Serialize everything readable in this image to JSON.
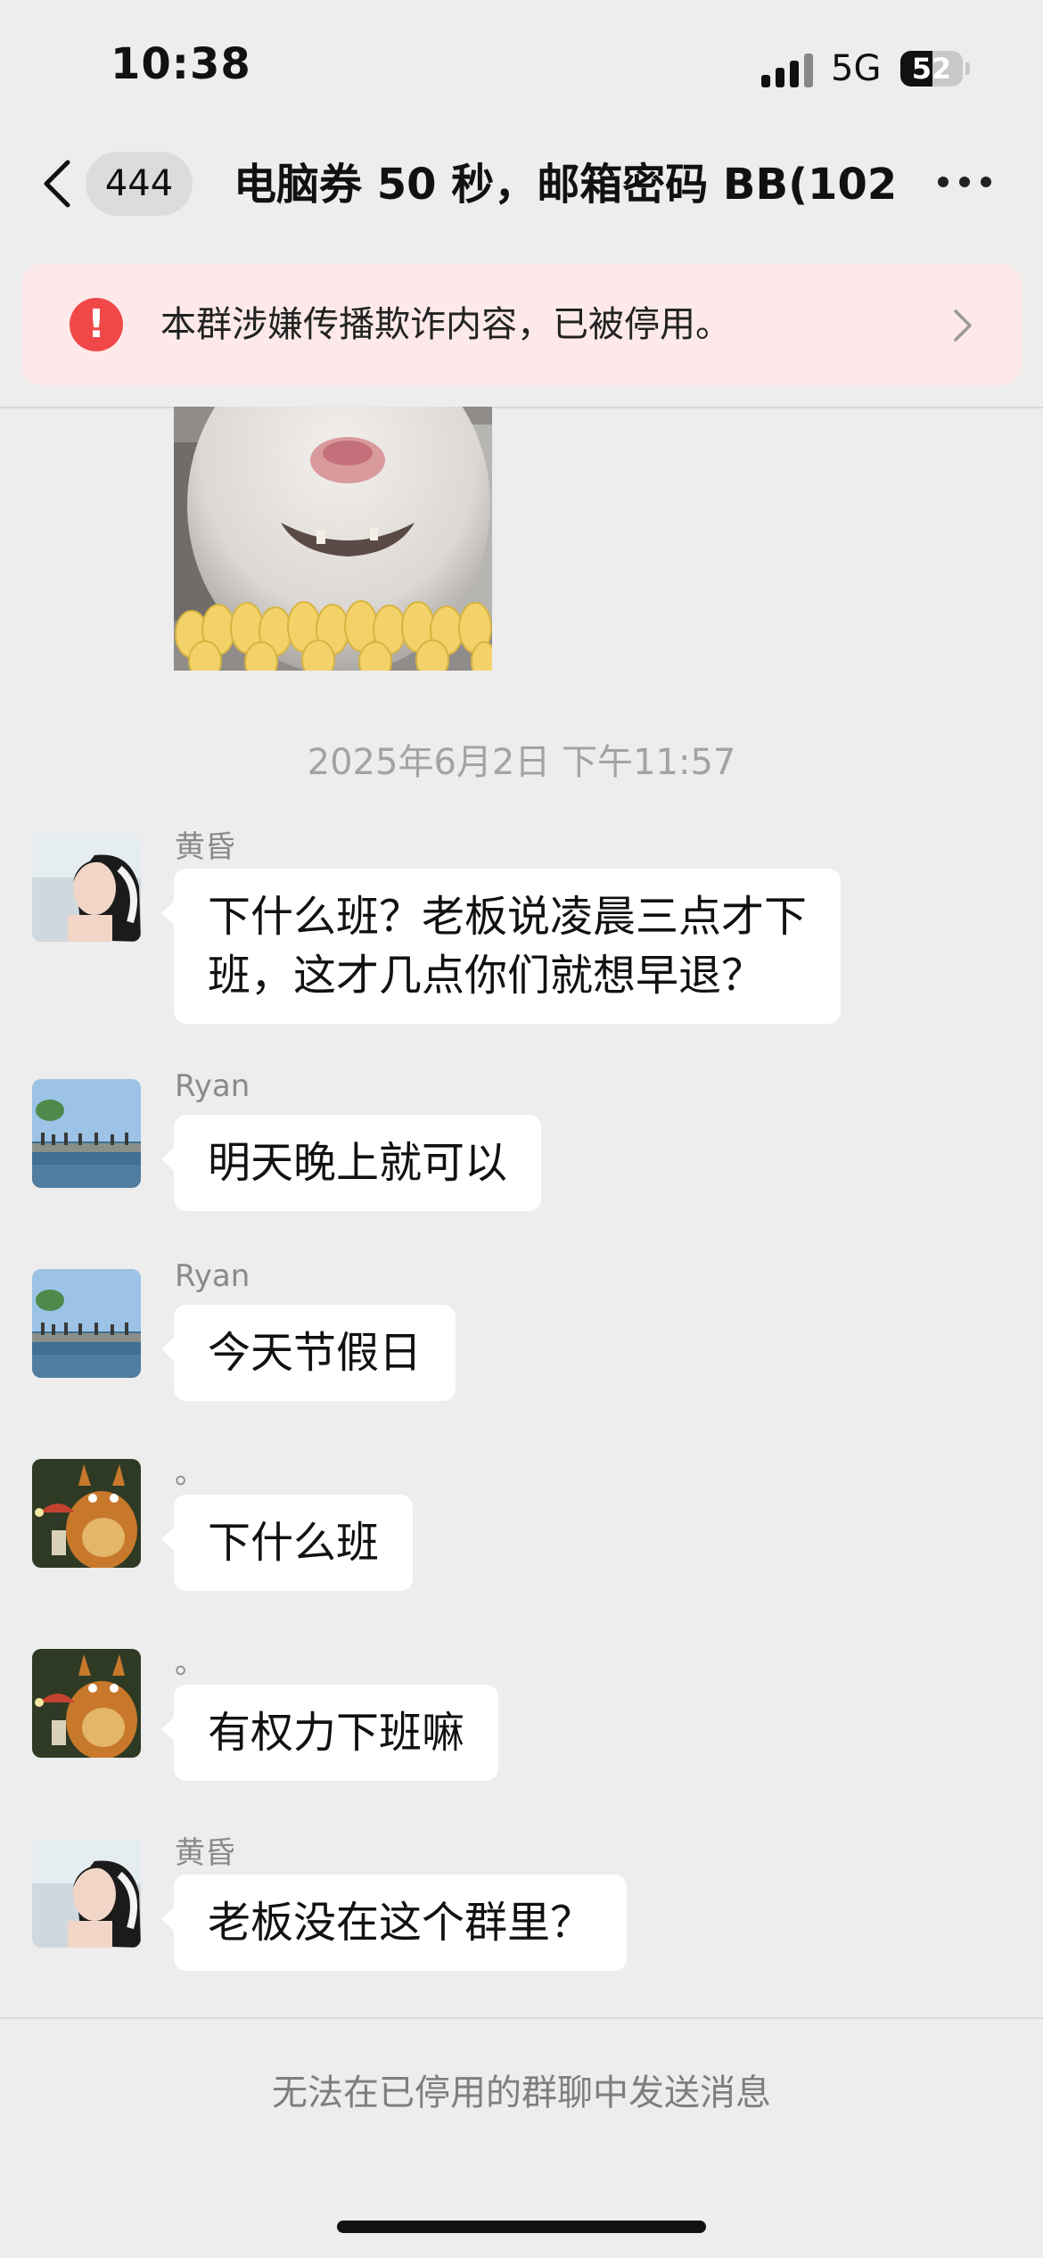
{
  "status_bar": {
    "time": "10:38",
    "network": "5G",
    "battery": "52",
    "battery_level": 0.52
  },
  "header": {
    "unread_count": "444",
    "title": "电脑券 50 秒，邮箱密码 BB(102)",
    "back_icon": "chevron-left-icon",
    "more_icon": "more-dots-icon"
  },
  "banner": {
    "text": "本群涉嫌传播欺诈内容，已被停用。",
    "icon": "exclamation-icon",
    "chevron": "chevron-right-icon"
  },
  "timestamp": "2025年6月2日 下午11:57",
  "messages": [
    {
      "sender": "黄昏",
      "lines": [
        "下什么班？老板说凌晨三点才下",
        "班，这才几点你们就想早退？"
      ]
    },
    {
      "sender": "Ryan",
      "lines": [
        "明天晚上就可以"
      ]
    },
    {
      "sender": "Ryan",
      "lines": [
        "今天节假日"
      ]
    },
    {
      "sender": "。",
      "lines": [
        "下什么班"
      ]
    },
    {
      "sender": "。",
      "lines": [
        "有权力下班嘛"
      ]
    },
    {
      "sender": "黄昏",
      "lines": [
        "老板没在这个群里？"
      ]
    }
  ],
  "footer": {
    "text": "无法在已停用的群聊中发送消息"
  },
  "colors": {
    "background": "#ededed",
    "banner_bg": "#fde9e9",
    "warning_red": "#f04848",
    "bubble": "#ffffff"
  }
}
